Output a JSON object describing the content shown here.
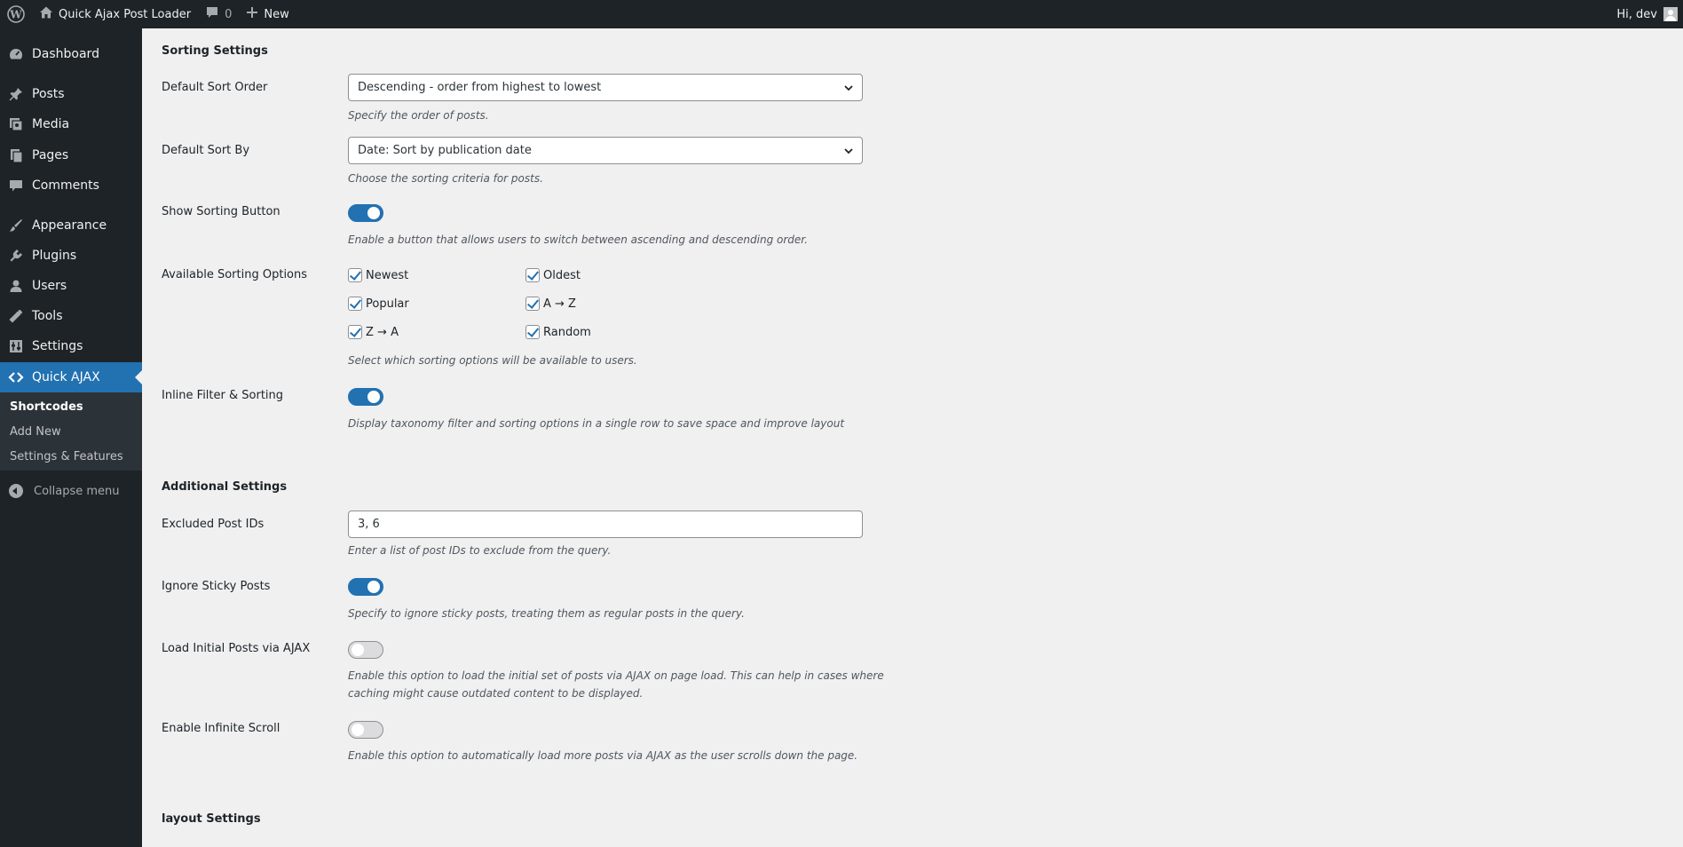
{
  "admin_bar": {
    "site_name": "Quick Ajax Post Loader",
    "comments_count": "0",
    "new_label": "New",
    "greeting": "Hi, dev"
  },
  "sidebar": {
    "items": [
      {
        "label": "Dashboard",
        "icon": "dashboard-icon"
      },
      {
        "label": "Posts",
        "icon": "pin-icon"
      },
      {
        "label": "Media",
        "icon": "media-icon"
      },
      {
        "label": "Pages",
        "icon": "pages-icon"
      },
      {
        "label": "Comments",
        "icon": "comment-icon"
      },
      {
        "label": "Appearance",
        "icon": "brush-icon"
      },
      {
        "label": "Plugins",
        "icon": "plugin-icon"
      },
      {
        "label": "Users",
        "icon": "user-icon"
      },
      {
        "label": "Tools",
        "icon": "wrench-icon"
      },
      {
        "label": "Settings",
        "icon": "settings-icon"
      },
      {
        "label": "Quick AJAX",
        "icon": "code-icon"
      }
    ],
    "submenu": [
      "Shortcodes",
      "Add New",
      "Settings & Features"
    ],
    "collapse_label": "Collapse menu"
  },
  "sorting": {
    "title": "Sorting Settings",
    "sort_order_label": "Default Sort Order",
    "sort_order_value": "Descending - order from highest to lowest",
    "sort_order_desc": "Specify the order of posts.",
    "sort_by_label": "Default Sort By",
    "sort_by_value": "Date: Sort by publication date",
    "sort_by_desc": "Choose the sorting criteria for posts.",
    "show_button_label": "Show Sorting Button",
    "show_button_desc": "Enable a button that allows users to switch between ascending and descending order.",
    "options_label": "Available Sorting Options",
    "options": [
      "Newest",
      "Oldest",
      "Popular",
      "A → Z",
      "Z → A",
      "Random"
    ],
    "options_desc": "Select which sorting options will be available to users.",
    "inline_label": "Inline Filter & Sorting",
    "inline_desc": "Display taxonomy filter and sorting options in a single row to save space and improve layout"
  },
  "additional": {
    "title": "Additional Settings",
    "excluded_label": "Excluded Post IDs",
    "excluded_value": "3, 6",
    "excluded_desc": "Enter a list of post IDs to exclude from the query.",
    "sticky_label": "Ignore Sticky Posts",
    "sticky_desc": "Specify to ignore sticky posts, treating them as regular posts in the query.",
    "load_initial_label": "Load Initial Posts via AJAX",
    "load_initial_desc_1": "Enable this option to load the initial set of posts via AJAX on page load. This can help in cases where",
    "load_initial_desc_2": "caching might cause outdated content to be displayed.",
    "infinite_label": "Enable Infinite Scroll",
    "infinite_desc": "Enable this option to automatically load more posts via AJAX as the user scrolls down the page."
  },
  "layout": {
    "title": "layout Settings"
  },
  "toggles": {
    "show_sorting_button": true,
    "inline_filter_sorting": true,
    "ignore_sticky_posts": true,
    "load_initial_via_ajax": false,
    "infinite_scroll": false
  },
  "colors": {
    "admin_bg": "#1d2327",
    "accent": "#2271b1",
    "page_bg": "#f0f0f1"
  }
}
